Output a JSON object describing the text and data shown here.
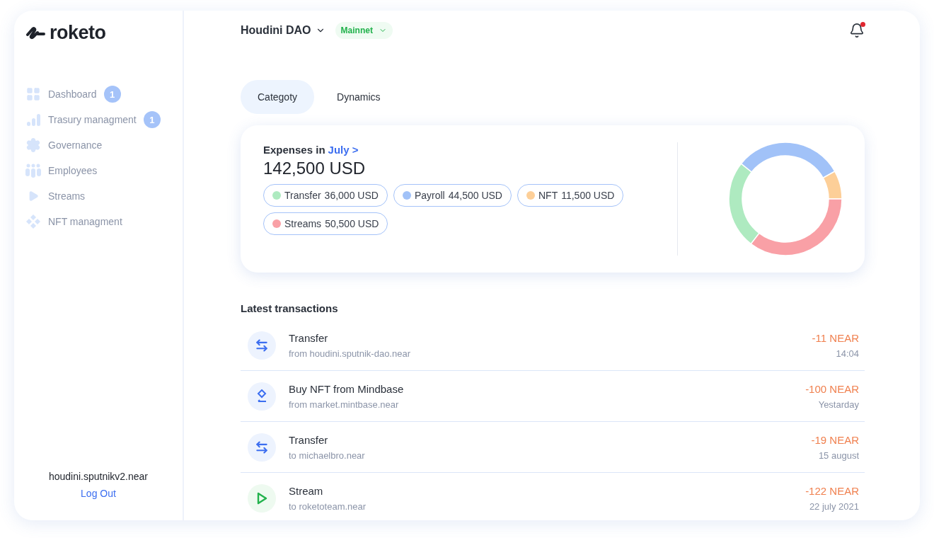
{
  "sidebar": {
    "logo": "roketo",
    "items": [
      {
        "kind": "dashboard",
        "label": "Dashboard",
        "badge": "1"
      },
      {
        "kind": "treasury",
        "label": "Trasury managment",
        "badge": "1"
      },
      {
        "kind": "governance",
        "label": "Governance"
      },
      {
        "kind": "employees",
        "label": "Employees"
      },
      {
        "kind": "streams",
        "label": "Streams"
      },
      {
        "kind": "nft",
        "label": "NFT managment"
      }
    ],
    "account": "houdini.sputnikv2.near",
    "logout": "Log Out"
  },
  "header": {
    "dao": "Houdini DAO",
    "network": "Mainnet",
    "notification_unread": true
  },
  "tabs": [
    {
      "label": "Categoty",
      "selected": true
    },
    {
      "label": "Dynamics",
      "selected": false
    }
  ],
  "expenses": {
    "title": "Expenses in",
    "month_link": "July >",
    "total": "142,500 USD",
    "chips": [
      {
        "label": "Transfer",
        "amount": "36,000 USD",
        "color": "#aeeac0"
      },
      {
        "label": "Payroll",
        "amount": "44,500 USD",
        "color": "#a1c2f8"
      },
      {
        "label": "NFT",
        "amount": "11,500 USD",
        "color": "#fdcf98"
      },
      {
        "label": "Streams",
        "amount": "50,500 USD",
        "color": "#f9a0a6"
      }
    ],
    "chart_data": {
      "type": "donut",
      "series": [
        {
          "values": [
            25.3,
            31.2,
            8.1,
            35.4
          ]
        }
      ]
    }
  },
  "transactions": {
    "title": "Latest transactions",
    "rows": [
      {
        "kind": "transfer",
        "title": "Transfer",
        "subtitle": "from houdini.sputnik-dao.near",
        "amount": "-11 NEAR",
        "time": "14:04"
      },
      {
        "kind": "nft",
        "title": "Buy NFT from Mindbase",
        "subtitle": "from market.mintbase.near",
        "amount": "-100 NEAR",
        "time": "Yestarday"
      },
      {
        "kind": "transfer",
        "title": "Transfer",
        "subtitle": "to michaelbro.near",
        "amount": "-19 NEAR",
        "time": "15 august"
      },
      {
        "kind": "stream",
        "title": "Stream",
        "subtitle": "to roketoteam.near",
        "amount": "-122 NEAR",
        "time": "22 july 2021"
      }
    ]
  }
}
